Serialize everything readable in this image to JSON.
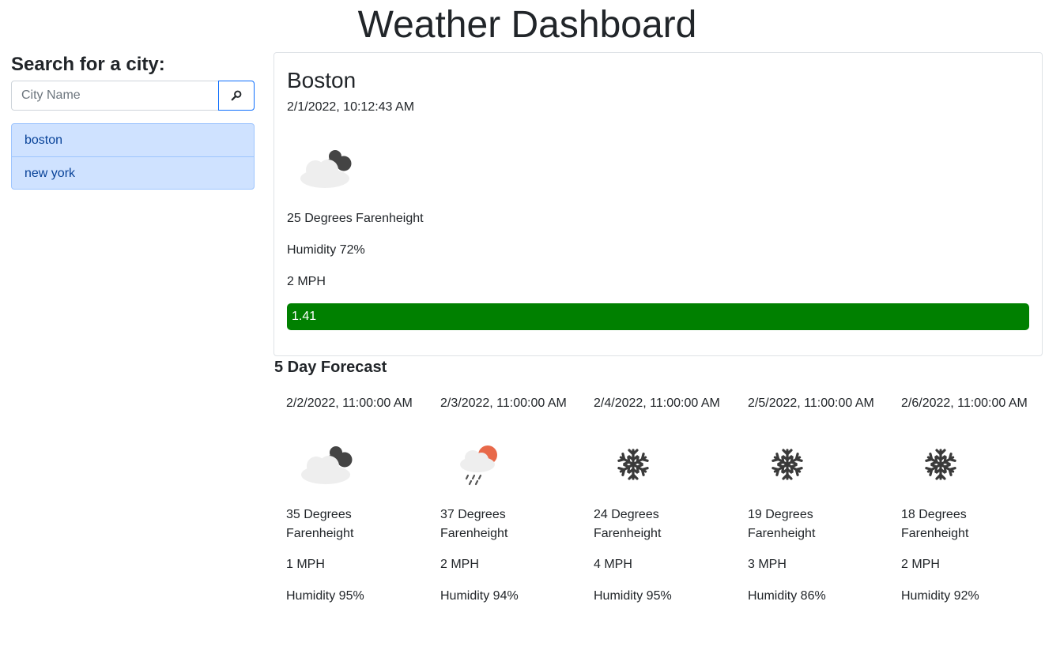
{
  "page": {
    "title": "Weather Dashboard"
  },
  "sidebar": {
    "heading": "Search for a city:",
    "search_placeholder": "City Name",
    "search_button_icon": "magnifier-icon",
    "history": [
      "boston",
      "new york"
    ]
  },
  "current": {
    "city": "Boston",
    "datetime": "2/1/2022, 10:12:43 AM",
    "icon": "cloudy-icon",
    "temperature": "25 Degrees Farenheight",
    "humidity": "Humidity 72%",
    "wind": "2 MPH",
    "uv_index": "1.41",
    "uv_color": "#008000"
  },
  "forecast": {
    "heading": "5 Day Forecast",
    "days": [
      {
        "date": "2/2/2022, 11:00:00 AM",
        "icon": "cloudy-icon",
        "temp": "35 Degrees Farenheight",
        "wind": "1 MPH",
        "humidity": "Humidity 95%"
      },
      {
        "date": "2/3/2022, 11:00:00 AM",
        "icon": "rain-sun-icon",
        "temp": "37 Degrees Farenheight",
        "wind": "2 MPH",
        "humidity": "Humidity 94%"
      },
      {
        "date": "2/4/2022, 11:00:00 AM",
        "icon": "snowflake-icon",
        "temp": "24 Degrees Farenheight",
        "wind": "4 MPH",
        "humidity": "Humidity 95%"
      },
      {
        "date": "2/5/2022, 11:00:00 AM",
        "icon": "snowflake-icon",
        "temp": "19 Degrees Farenheight",
        "wind": "3 MPH",
        "humidity": "Humidity 86%"
      },
      {
        "date": "2/6/2022, 11:00:00 AM",
        "icon": "snowflake-icon",
        "temp": "18 Degrees Farenheight",
        "wind": "2 MPH",
        "humidity": "Humidity 92%"
      }
    ]
  }
}
